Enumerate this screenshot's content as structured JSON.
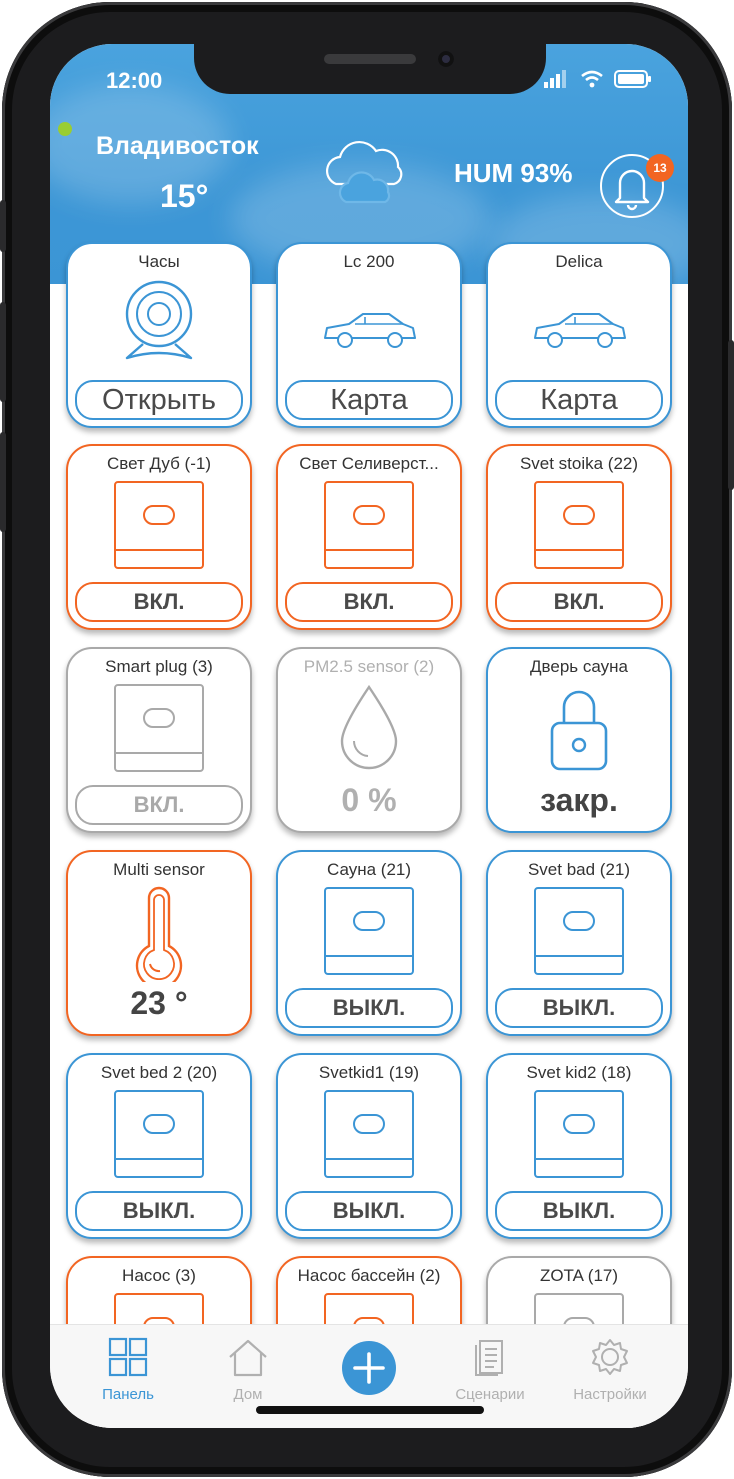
{
  "status_bar": {
    "time": "12:00"
  },
  "header": {
    "city": "Владивосток",
    "temperature": "15°",
    "humidity": "HUM 93%",
    "notifications_count": "13"
  },
  "tiles": [
    {
      "title": "Часы",
      "kind": "camera",
      "color": "#3b95d5",
      "action": "Открыть"
    },
    {
      "title": "Lc 200",
      "kind": "car",
      "color": "#3b95d5",
      "action": "Карта"
    },
    {
      "title": "Delica",
      "kind": "car",
      "color": "#3b95d5",
      "action": "Карта"
    },
    {
      "title": "Свет Дуб (-1)",
      "kind": "switch",
      "color": "#f26522",
      "action": "ВКЛ."
    },
    {
      "title": "Свет Селиверст...",
      "kind": "switch",
      "color": "#f26522",
      "action": "ВКЛ."
    },
    {
      "title": "Svet stoika (22)",
      "kind": "switch",
      "color": "#f26522",
      "action": "ВКЛ."
    },
    {
      "title": "Smart plug (3)",
      "kind": "switch",
      "color": "#a9a9a9",
      "action": "ВКЛ."
    },
    {
      "title": "PM2.5 sensor (2)",
      "kind": "drop",
      "color": "#a9a9a9",
      "value": "0 %"
    },
    {
      "title": "Дверь сауна",
      "kind": "lock",
      "color": "#3b95d5",
      "value": "закр."
    },
    {
      "title": "Multi sensor",
      "kind": "thermo",
      "color": "#f26522",
      "value": "23 °"
    },
    {
      "title": "Сауна (21)",
      "kind": "switch",
      "color": "#3b95d5",
      "action": "ВЫКЛ."
    },
    {
      "title": "Svet bad (21)",
      "kind": "switch",
      "color": "#3b95d5",
      "action": "ВЫКЛ."
    },
    {
      "title": "Svet bed 2 (20)",
      "kind": "switch",
      "color": "#3b95d5",
      "action": "ВЫКЛ."
    },
    {
      "title": "Svetkid1 (19)",
      "kind": "switch",
      "color": "#3b95d5",
      "action": "ВЫКЛ."
    },
    {
      "title": "Svet kid2 (18)",
      "kind": "switch",
      "color": "#3b95d5",
      "action": "ВЫКЛ."
    },
    {
      "title": "Насос (3)",
      "kind": "switch",
      "color": "#f26522"
    },
    {
      "title": "Насос бассейн (2)",
      "kind": "switch",
      "color": "#f26522"
    },
    {
      "title": "ZOTA (17)",
      "kind": "switch",
      "color": "#a9a9a9"
    }
  ],
  "tabbar": {
    "panel": "Панель",
    "home": "Дом",
    "scenarios": "Сценарии",
    "settings": "Настройки"
  },
  "colors": {
    "accent": "#3b95d5",
    "on": "#f26522",
    "offline": "#a9a9a9"
  }
}
